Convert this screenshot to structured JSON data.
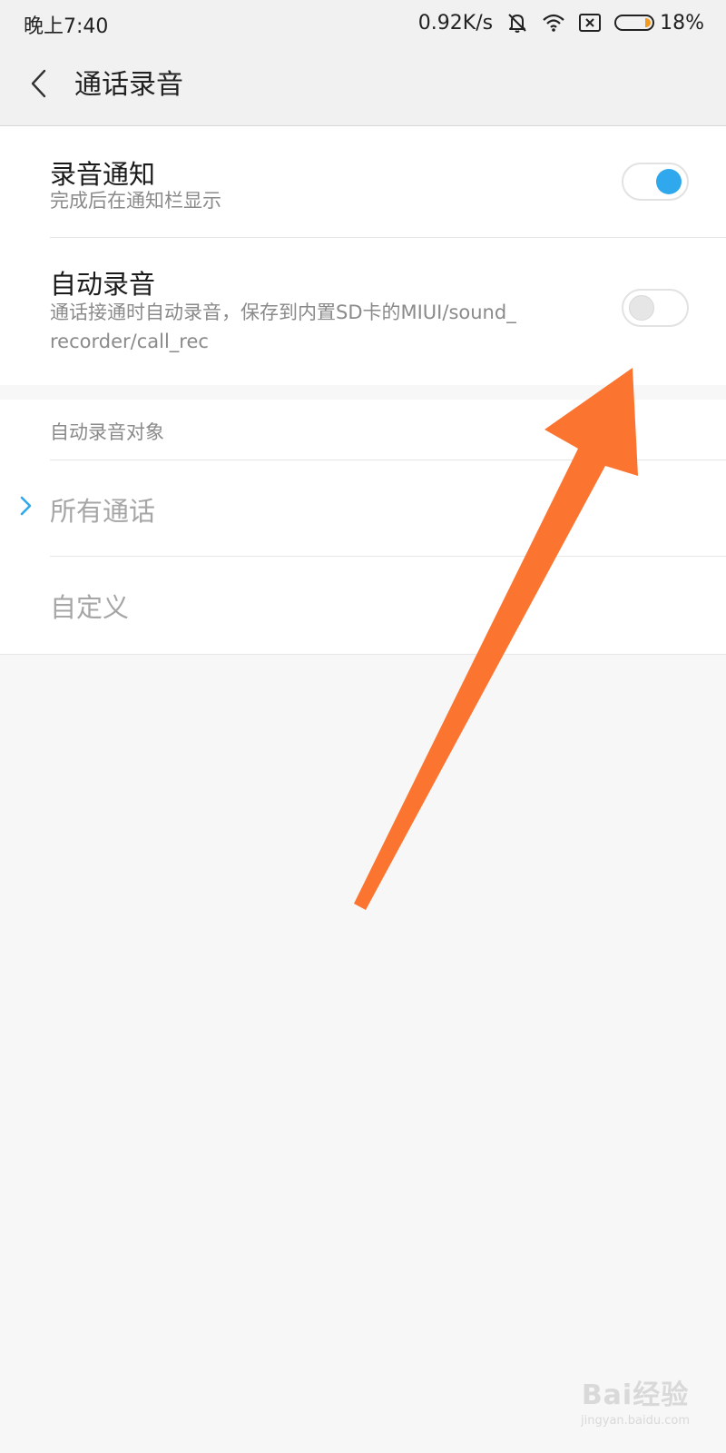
{
  "status_bar": {
    "time": "晚上7:40",
    "net_speed": "0.92K/s",
    "battery_percent": "18%",
    "battery_level": 0.18,
    "icons": [
      "mute-bell-icon",
      "wifi-icon",
      "sim-x-icon",
      "battery-icon"
    ]
  },
  "header": {
    "title": "通话录音",
    "back_icon": "chevron-left-icon"
  },
  "settings": {
    "notify": {
      "title": "录音通知",
      "subtitle": "完成后在通知栏显示",
      "enabled": true
    },
    "auto_record": {
      "title": "自动录音",
      "subtitle": "通话接通时自动录音，保存到内置SD卡的MIUI/sound_recorder/call_rec",
      "enabled": false
    }
  },
  "auto_target": {
    "section_label": "自动录音对象",
    "options": [
      {
        "label": "所有通话",
        "selected": true
      },
      {
        "label": "自定义",
        "selected": false
      }
    ]
  },
  "watermark": {
    "main": "Bai经验",
    "sub": "jingyan.baidu.com"
  },
  "colors": {
    "accent": "#2fa8ee",
    "annotation_arrow": "#fb7530",
    "battery": "#f39a1f"
  }
}
